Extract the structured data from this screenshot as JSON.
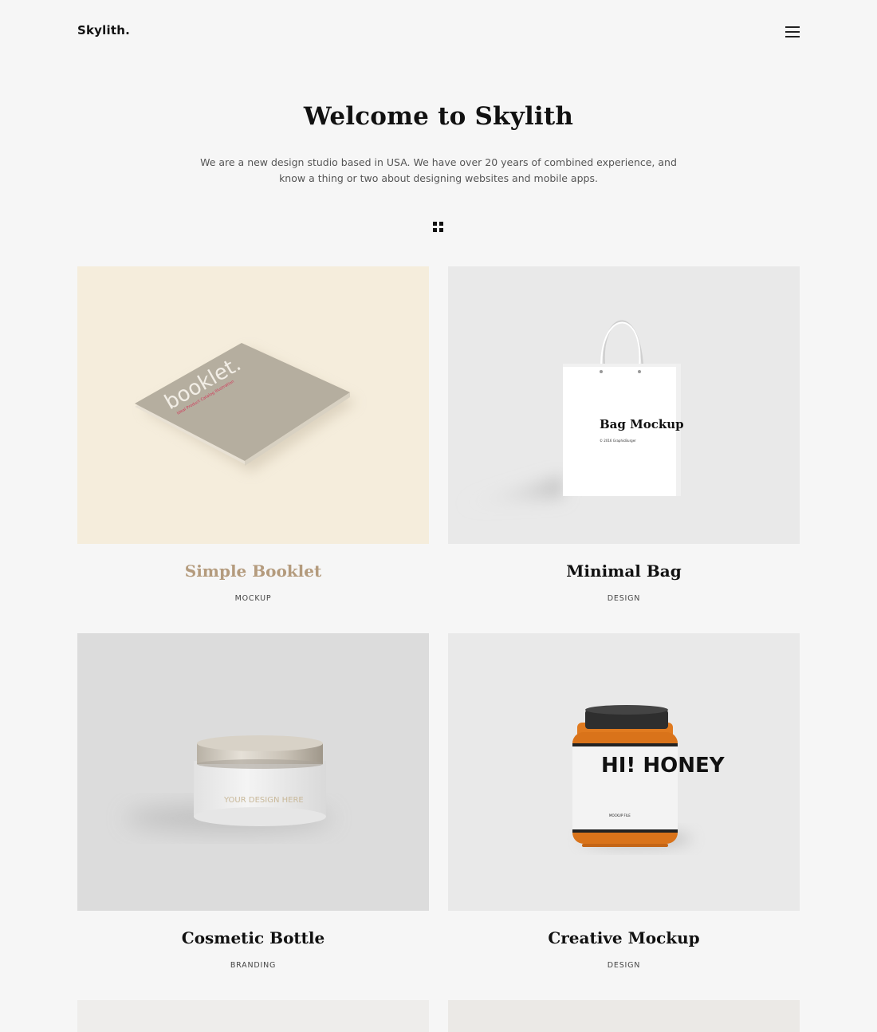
{
  "brand": {
    "logo": "Skylith."
  },
  "hero": {
    "title": "Welcome to Skylith",
    "description": "We are a new design studio based in USA. We have over 20 years of combined experience, and know a thing or two about designing websites and mobile apps."
  },
  "portfolio": {
    "items": [
      {
        "title": "Simple Booklet",
        "category": "MOCKUP",
        "thumb_text": "booklet.",
        "thumb_subtext": "Ideal Product Catalog Illustration",
        "title_color": "#b49b7d"
      },
      {
        "title": "Minimal Bag",
        "category": "DESIGN",
        "thumb_text": "Bag Mockup",
        "thumb_subtext": "© 2016 GraphicBurger"
      },
      {
        "title": "Cosmetic Bottle",
        "category": "BRANDING",
        "thumb_text": "YOUR DESIGN HERE"
      },
      {
        "title": "Creative Mockup",
        "category": "DESIGN",
        "thumb_text": "HI! HONEY",
        "thumb_subtext": "MOCKUP FILE"
      }
    ]
  },
  "colors": {
    "background": "#f6f6f6",
    "accent": "#b49b7d",
    "text": "#111111"
  },
  "icons": {
    "menu": "hamburger-menu-icon",
    "filter": "grid-filter-icon"
  }
}
